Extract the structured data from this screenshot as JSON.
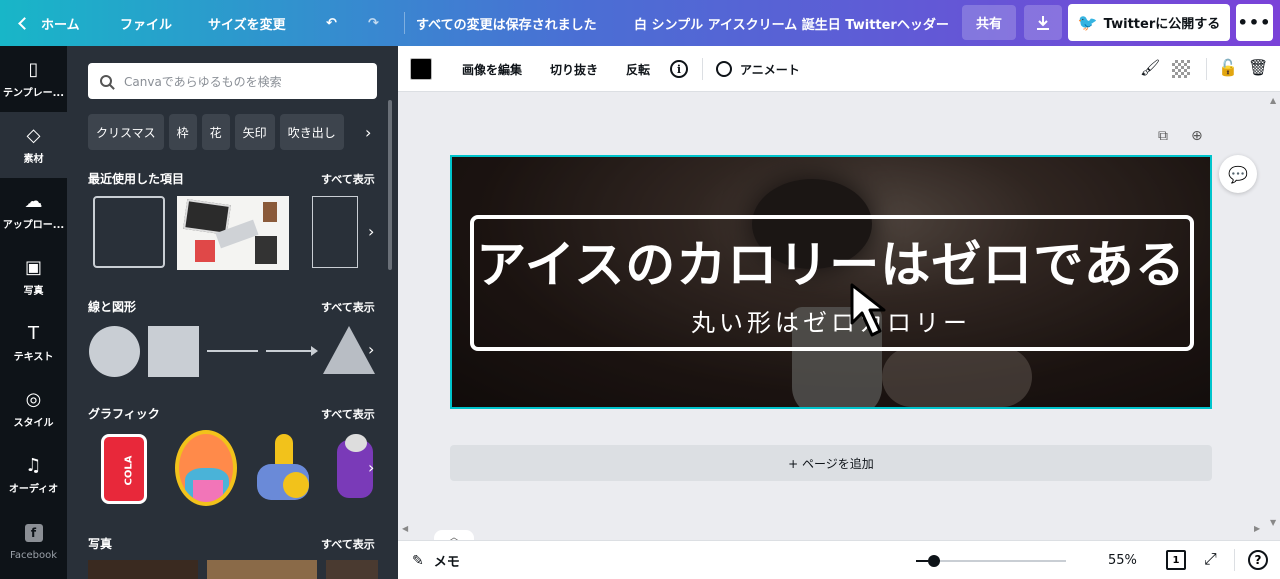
{
  "topbar": {
    "home_label": "ホーム",
    "file_label": "ファイル",
    "resize_label": "サイズを変更",
    "undo_icon": "undo-icon",
    "redo_icon": "redo-icon",
    "save_status": "すべての変更は保存されました",
    "document_title": "白 シンプル アイスクリーム 誕生日 Twitterヘッダー",
    "share_label": "共有",
    "download_icon": "download-icon",
    "publish_label": "Twitterに公開する",
    "more_label": "•••"
  },
  "rail": {
    "items": [
      {
        "label": "テンプレー...",
        "icon": "template-icon"
      },
      {
        "label": "素材",
        "icon": "elements-icon"
      },
      {
        "label": "アップロー...",
        "icon": "upload-icon"
      },
      {
        "label": "写真",
        "icon": "photo-icon"
      },
      {
        "label": "テキスト",
        "icon": "text-icon"
      },
      {
        "label": "スタイル",
        "icon": "palette-icon"
      },
      {
        "label": "オーディオ",
        "icon": "music-icon"
      }
    ],
    "facebook_label": "Facebook"
  },
  "panel": {
    "search_placeholder": "Canvaであらゆるものを検索",
    "chips": [
      "クリスマス",
      "枠",
      "花",
      "矢印",
      "吹き出し"
    ],
    "sections": {
      "recent": {
        "title": "最近使用した項目",
        "see_all": "すべて表示"
      },
      "lines": {
        "title": "線と図形",
        "see_all": "すべて表示"
      },
      "graphics": {
        "title": "グラフィック",
        "see_all": "すべて表示"
      },
      "photos": {
        "title": "写真",
        "see_all": "すべて表示"
      }
    },
    "can_text": "COLA"
  },
  "toolbar": {
    "color": "#000000",
    "edit_image": "画像を編集",
    "crop": "切り抜き",
    "flip": "反転",
    "info": "i",
    "animate": "アニメート"
  },
  "canvas": {
    "heading": "アイスのカロリーはゼロである",
    "subheading": "丸い形はゼロカロリー",
    "add_page": "+ ページを追加"
  },
  "bottombar": {
    "notes": "メモ",
    "zoom_level": 0.55,
    "zoom_label": "55%",
    "page_count": "1",
    "help": "?"
  },
  "colors": {
    "accent": "#00c4cc",
    "rail_bg": "#0e1318",
    "panel_bg": "#293039",
    "twitter": "#1da1f2"
  }
}
